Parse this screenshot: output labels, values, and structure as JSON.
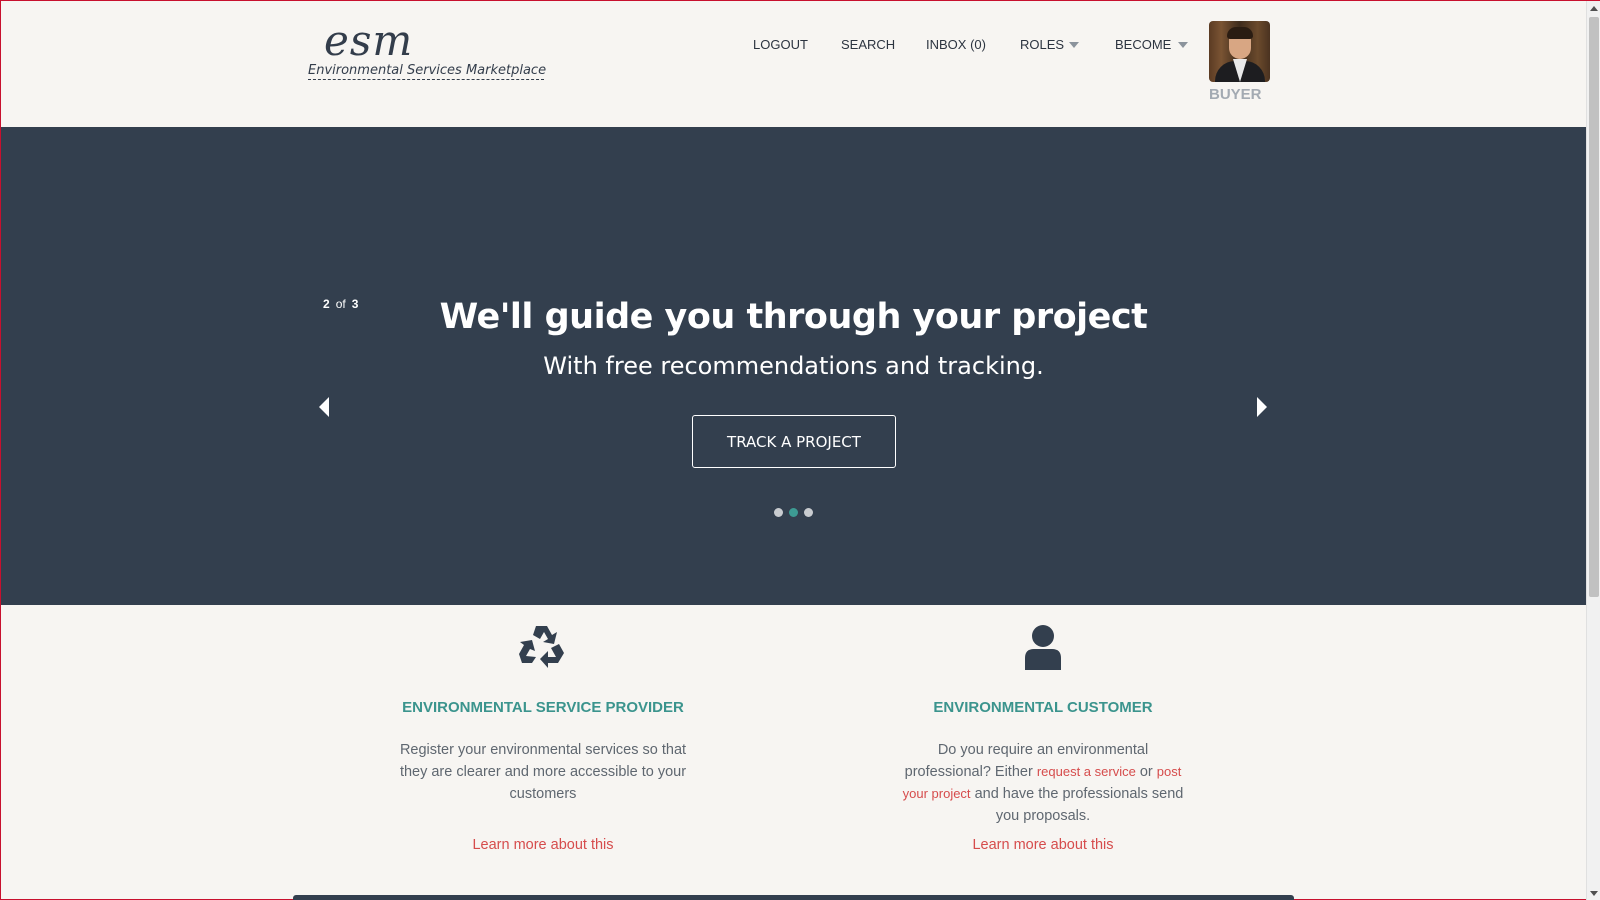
{
  "header": {
    "logo_mark": "esm",
    "logo_subtitle": "Environmental Services Marketplace",
    "nav": {
      "logout": "LOGOUT",
      "search": "SEARCH",
      "inbox": "INBOX (0)",
      "roles": "ROLES",
      "become": "BECOME"
    },
    "user_role": "BUYER"
  },
  "hero": {
    "slide_current": "2",
    "slide_of": "of",
    "slide_total": "3",
    "title": "We'll guide you through your project",
    "subtitle": "With free recommendations and tracking.",
    "cta_label": "TRACK A PROJECT",
    "active_dot": 2,
    "dot_count": 3
  },
  "features": {
    "provider": {
      "icon": "recycle-icon",
      "title": "ENVIRONMENTAL SERVICE PROVIDER",
      "text": "Register your environmental services so that they are clearer and more accessible to your customers",
      "learn_more": "Learn more about this"
    },
    "customer": {
      "icon": "user-icon",
      "title": "ENVIRONMENTAL CUSTOMER",
      "text_before": "Do you require an environmental professional? Either ",
      "link_request": "request a service",
      "text_or": " or ",
      "link_post": "post your project",
      "text_after": " and have the professionals send you proposals.",
      "learn_more": "Learn more about this"
    }
  },
  "colors": {
    "hero_bg": "#333f4e",
    "accent_teal": "#3b948d",
    "link_red": "#d64c4c",
    "page_bg": "#f7f5f2"
  }
}
